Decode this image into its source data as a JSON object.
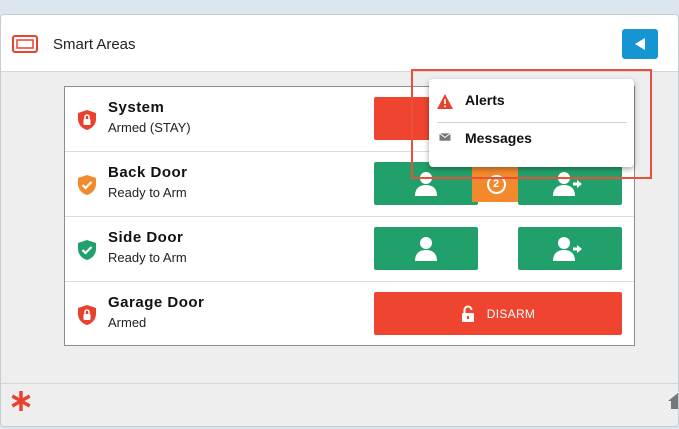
{
  "header": {
    "title": "Smart Areas",
    "back_icon": "back-arrow-icon"
  },
  "areas": [
    {
      "name": "System",
      "status": "Armed (STAY)",
      "state": "armed",
      "shield_color": "#e8422f"
    },
    {
      "name": "Back Door",
      "status": "Ready to Arm",
      "state": "ready",
      "shield_color": "#f28a2e",
      "badge": "2"
    },
    {
      "name": "Side Door",
      "status": "Ready to Arm",
      "state": "ready",
      "shield_color": "#22a06b"
    },
    {
      "name": "Garage Door",
      "status": "Armed",
      "state": "armed",
      "shield_color": "#e8422f",
      "action_label": "DISARM"
    }
  ],
  "menu": {
    "items": [
      {
        "label": "Alerts",
        "icon": "warning-icon"
      },
      {
        "label": "Messages",
        "icon": "envelope-icon"
      }
    ]
  },
  "colors": {
    "green": "#22a06b",
    "red": "#ef4530",
    "orange": "#f2892d",
    "blue": "#1596d2",
    "highlight": "#e8503a"
  },
  "footer": {
    "logo_icon": "asterisk-icon",
    "home_icon": "home-icon"
  }
}
